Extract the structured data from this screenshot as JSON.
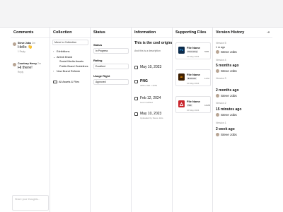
{
  "columns": {
    "comments": "Comments",
    "collection": "Collection",
    "status": "Status",
    "information": "Information",
    "files": "Supporting Files",
    "versions": "Version History"
  },
  "comments": {
    "items": [
      {
        "name": "Steve Jobs",
        "time": "2m",
        "text": "Hello 👋",
        "replies": "1 Reply"
      },
      {
        "name": "Courtney Henry",
        "time": "2m",
        "text": "Hi there!",
        "replies": "Reply"
      }
    ],
    "placeholder": "Share your thoughts..."
  },
  "collection": {
    "move_label": "Move to Collection",
    "tree": [
      {
        "label": "Exhibitions",
        "chevron": "›",
        "indent": 0
      },
      {
        "label": "Airbnb Brand",
        "chevron": "⌄",
        "indent": 0
      },
      {
        "label": "Social Media Assets",
        "chevron": "",
        "indent": 1
      },
      {
        "label": "Public Brand Guidelines",
        "chevron": "",
        "indent": 1
      },
      {
        "label": "New Brand Refresh",
        "chevron": "›",
        "indent": 0
      }
    ],
    "all_assets": "All Assets & Files"
  },
  "status": {
    "status_label": "Status",
    "status_value": "In Progress",
    "rating_label": "Rating",
    "rating_value": "Excellent",
    "usage_label": "Usage Right",
    "usage_value": "Approved"
  },
  "information": {
    "title": "This is the cool original file assigned to this specific",
    "description": "And this is a description",
    "rows": [
      {
        "icon": "calendar-icon",
        "main": "May 10, 2023",
        "sub": ""
      },
      {
        "icon": "file-type-icon",
        "main": "PNG",
        "sub": "3051L 820 × 2051"
      },
      {
        "icon": "edit-clock-icon",
        "main": "Feb 12, 2024",
        "sub": "Last modified"
      },
      {
        "icon": "upload-icon",
        "main": "May 10, 2023",
        "sub": "Uploaded by Steve Jobs"
      }
    ]
  },
  "files": [
    {
      "name": "File Name",
      "app": "Photoshop",
      "size": "5MB",
      "date": "10 May 2024",
      "badge": "Ps",
      "color": "#0b2a4a"
    },
    {
      "name": "File Name",
      "app": "Illustrator",
      "size": "12 M",
      "date": "10 May 2024",
      "badge": "Ai",
      "color": "#3b1d00"
    },
    {
      "name": "File Name",
      "app": "PDF",
      "size": "10MB",
      "date": "10 May 2024",
      "badge": "⬛",
      "color": "#c9252c"
    }
  ],
  "versions": [
    {
      "label": "Version 5",
      "time": "",
      "user": "Steve Jobs",
      "prefix": "1 m ago"
    },
    {
      "label": "Version 4",
      "time": "5 months ago",
      "user": "Steve Jobs"
    },
    {
      "label": "Version 3",
      "time": "2 months ago",
      "user": "Steve Jobs"
    },
    {
      "label": "Version 2",
      "time": "15 minutes ago",
      "user": "Steve Jobs"
    },
    {
      "label": "Version 1",
      "time": "2 week ago",
      "user": "Steve Jobs"
    }
  ]
}
